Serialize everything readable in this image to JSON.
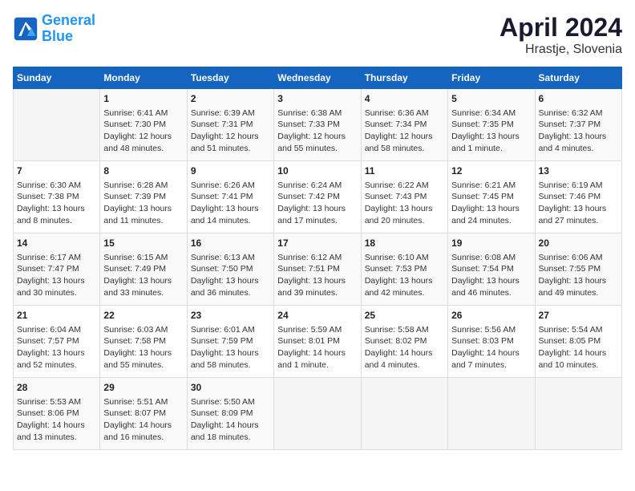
{
  "header": {
    "logo_general": "General",
    "logo_blue": "Blue",
    "title": "April 2024",
    "subtitle": "Hrastje, Slovenia"
  },
  "days_of_week": [
    "Sunday",
    "Monday",
    "Tuesday",
    "Wednesday",
    "Thursday",
    "Friday",
    "Saturday"
  ],
  "weeks": [
    [
      {
        "day": "",
        "sunrise": "",
        "sunset": "",
        "daylight": ""
      },
      {
        "day": "1",
        "sunrise": "Sunrise: 6:41 AM",
        "sunset": "Sunset: 7:30 PM",
        "daylight": "Daylight: 12 hours and 48 minutes."
      },
      {
        "day": "2",
        "sunrise": "Sunrise: 6:39 AM",
        "sunset": "Sunset: 7:31 PM",
        "daylight": "Daylight: 12 hours and 51 minutes."
      },
      {
        "day": "3",
        "sunrise": "Sunrise: 6:38 AM",
        "sunset": "Sunset: 7:33 PM",
        "daylight": "Daylight: 12 hours and 55 minutes."
      },
      {
        "day": "4",
        "sunrise": "Sunrise: 6:36 AM",
        "sunset": "Sunset: 7:34 PM",
        "daylight": "Daylight: 12 hours and 58 minutes."
      },
      {
        "day": "5",
        "sunrise": "Sunrise: 6:34 AM",
        "sunset": "Sunset: 7:35 PM",
        "daylight": "Daylight: 13 hours and 1 minute."
      },
      {
        "day": "6",
        "sunrise": "Sunrise: 6:32 AM",
        "sunset": "Sunset: 7:37 PM",
        "daylight": "Daylight: 13 hours and 4 minutes."
      }
    ],
    [
      {
        "day": "7",
        "sunrise": "Sunrise: 6:30 AM",
        "sunset": "Sunset: 7:38 PM",
        "daylight": "Daylight: 13 hours and 8 minutes."
      },
      {
        "day": "8",
        "sunrise": "Sunrise: 6:28 AM",
        "sunset": "Sunset: 7:39 PM",
        "daylight": "Daylight: 13 hours and 11 minutes."
      },
      {
        "day": "9",
        "sunrise": "Sunrise: 6:26 AM",
        "sunset": "Sunset: 7:41 PM",
        "daylight": "Daylight: 13 hours and 14 minutes."
      },
      {
        "day": "10",
        "sunrise": "Sunrise: 6:24 AM",
        "sunset": "Sunset: 7:42 PM",
        "daylight": "Daylight: 13 hours and 17 minutes."
      },
      {
        "day": "11",
        "sunrise": "Sunrise: 6:22 AM",
        "sunset": "Sunset: 7:43 PM",
        "daylight": "Daylight: 13 hours and 20 minutes."
      },
      {
        "day": "12",
        "sunrise": "Sunrise: 6:21 AM",
        "sunset": "Sunset: 7:45 PM",
        "daylight": "Daylight: 13 hours and 24 minutes."
      },
      {
        "day": "13",
        "sunrise": "Sunrise: 6:19 AM",
        "sunset": "Sunset: 7:46 PM",
        "daylight": "Daylight: 13 hours and 27 minutes."
      }
    ],
    [
      {
        "day": "14",
        "sunrise": "Sunrise: 6:17 AM",
        "sunset": "Sunset: 7:47 PM",
        "daylight": "Daylight: 13 hours and 30 minutes."
      },
      {
        "day": "15",
        "sunrise": "Sunrise: 6:15 AM",
        "sunset": "Sunset: 7:49 PM",
        "daylight": "Daylight: 13 hours and 33 minutes."
      },
      {
        "day": "16",
        "sunrise": "Sunrise: 6:13 AM",
        "sunset": "Sunset: 7:50 PM",
        "daylight": "Daylight: 13 hours and 36 minutes."
      },
      {
        "day": "17",
        "sunrise": "Sunrise: 6:12 AM",
        "sunset": "Sunset: 7:51 PM",
        "daylight": "Daylight: 13 hours and 39 minutes."
      },
      {
        "day": "18",
        "sunrise": "Sunrise: 6:10 AM",
        "sunset": "Sunset: 7:53 PM",
        "daylight": "Daylight: 13 hours and 42 minutes."
      },
      {
        "day": "19",
        "sunrise": "Sunrise: 6:08 AM",
        "sunset": "Sunset: 7:54 PM",
        "daylight": "Daylight: 13 hours and 46 minutes."
      },
      {
        "day": "20",
        "sunrise": "Sunrise: 6:06 AM",
        "sunset": "Sunset: 7:55 PM",
        "daylight": "Daylight: 13 hours and 49 minutes."
      }
    ],
    [
      {
        "day": "21",
        "sunrise": "Sunrise: 6:04 AM",
        "sunset": "Sunset: 7:57 PM",
        "daylight": "Daylight: 13 hours and 52 minutes."
      },
      {
        "day": "22",
        "sunrise": "Sunrise: 6:03 AM",
        "sunset": "Sunset: 7:58 PM",
        "daylight": "Daylight: 13 hours and 55 minutes."
      },
      {
        "day": "23",
        "sunrise": "Sunrise: 6:01 AM",
        "sunset": "Sunset: 7:59 PM",
        "daylight": "Daylight: 13 hours and 58 minutes."
      },
      {
        "day": "24",
        "sunrise": "Sunrise: 5:59 AM",
        "sunset": "Sunset: 8:01 PM",
        "daylight": "Daylight: 14 hours and 1 minute."
      },
      {
        "day": "25",
        "sunrise": "Sunrise: 5:58 AM",
        "sunset": "Sunset: 8:02 PM",
        "daylight": "Daylight: 14 hours and 4 minutes."
      },
      {
        "day": "26",
        "sunrise": "Sunrise: 5:56 AM",
        "sunset": "Sunset: 8:03 PM",
        "daylight": "Daylight: 14 hours and 7 minutes."
      },
      {
        "day": "27",
        "sunrise": "Sunrise: 5:54 AM",
        "sunset": "Sunset: 8:05 PM",
        "daylight": "Daylight: 14 hours and 10 minutes."
      }
    ],
    [
      {
        "day": "28",
        "sunrise": "Sunrise: 5:53 AM",
        "sunset": "Sunset: 8:06 PM",
        "daylight": "Daylight: 14 hours and 13 minutes."
      },
      {
        "day": "29",
        "sunrise": "Sunrise: 5:51 AM",
        "sunset": "Sunset: 8:07 PM",
        "daylight": "Daylight: 14 hours and 16 minutes."
      },
      {
        "day": "30",
        "sunrise": "Sunrise: 5:50 AM",
        "sunset": "Sunset: 8:09 PM",
        "daylight": "Daylight: 14 hours and 18 minutes."
      },
      {
        "day": "",
        "sunrise": "",
        "sunset": "",
        "daylight": ""
      },
      {
        "day": "",
        "sunrise": "",
        "sunset": "",
        "daylight": ""
      },
      {
        "day": "",
        "sunrise": "",
        "sunset": "",
        "daylight": ""
      },
      {
        "day": "",
        "sunrise": "",
        "sunset": "",
        "daylight": ""
      }
    ]
  ]
}
